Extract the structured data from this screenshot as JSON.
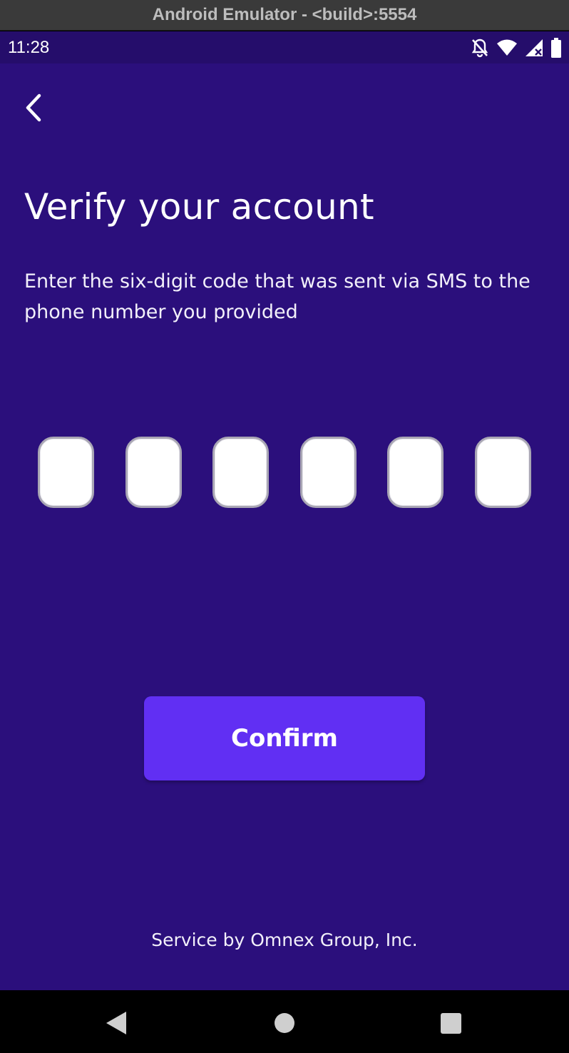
{
  "window": {
    "title": "Android Emulator - <build>:5554"
  },
  "status_bar": {
    "time": "11:28",
    "icons": [
      "bell-off-icon",
      "wifi-icon",
      "cellular-signal-icon",
      "battery-icon"
    ]
  },
  "screen": {
    "back_icon": "chevron-left-icon",
    "title": "Verify your account",
    "subtitle": "Enter the six-digit code that was sent via SMS to the phone number you provided",
    "otp": {
      "length": 6,
      "digits": [
        "",
        "",
        "",
        "",
        "",
        ""
      ]
    },
    "confirm_label": "Confirm",
    "footer": "Service by Omnex Group, Inc.",
    "colors": {
      "background": "#2b0f7c",
      "status_bar": "#250d6b",
      "button": "#612ff3"
    }
  },
  "nav_bar": {
    "buttons": [
      "nav-back-icon",
      "nav-home-icon",
      "nav-recents-icon"
    ]
  }
}
